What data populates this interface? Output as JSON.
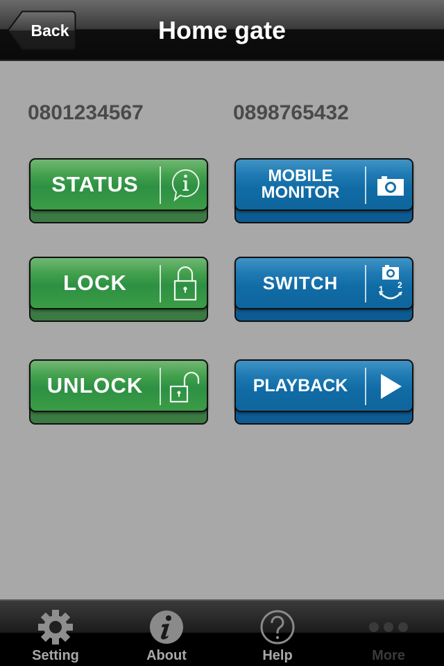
{
  "nav": {
    "back_label": "Back",
    "title": "Home gate"
  },
  "phones": {
    "left": "0801234567",
    "right": "0898765432"
  },
  "buttons": {
    "status": {
      "label": "STATUS",
      "icon": "info-bubble-icon",
      "color": "#2d9043"
    },
    "mobile_monitor": {
      "line1": "MOBILE",
      "line2": "MONITOR",
      "icon": "camera-icon",
      "color": "#106ba5"
    },
    "lock": {
      "label": "LOCK",
      "icon": "lock-closed-icon",
      "color": "#2d9043"
    },
    "switch": {
      "label": "SWITCH",
      "icon": "camera-switch-icon",
      "icon_num_1": "1",
      "icon_num_2": "2",
      "color": "#106ba5"
    },
    "unlock": {
      "label": "UNLOCK",
      "icon": "lock-open-icon",
      "color": "#2d9043"
    },
    "playback": {
      "label": "PLAYBACK",
      "icon": "play-icon",
      "color": "#106ba5"
    }
  },
  "tabbar": {
    "items": [
      {
        "label": "Setting",
        "icon": "gear-icon"
      },
      {
        "label": "About",
        "icon": "info-icon"
      },
      {
        "label": "Help",
        "icon": "help-icon"
      },
      {
        "label": "More",
        "icon": "more-icon",
        "state": "disabled"
      }
    ]
  }
}
